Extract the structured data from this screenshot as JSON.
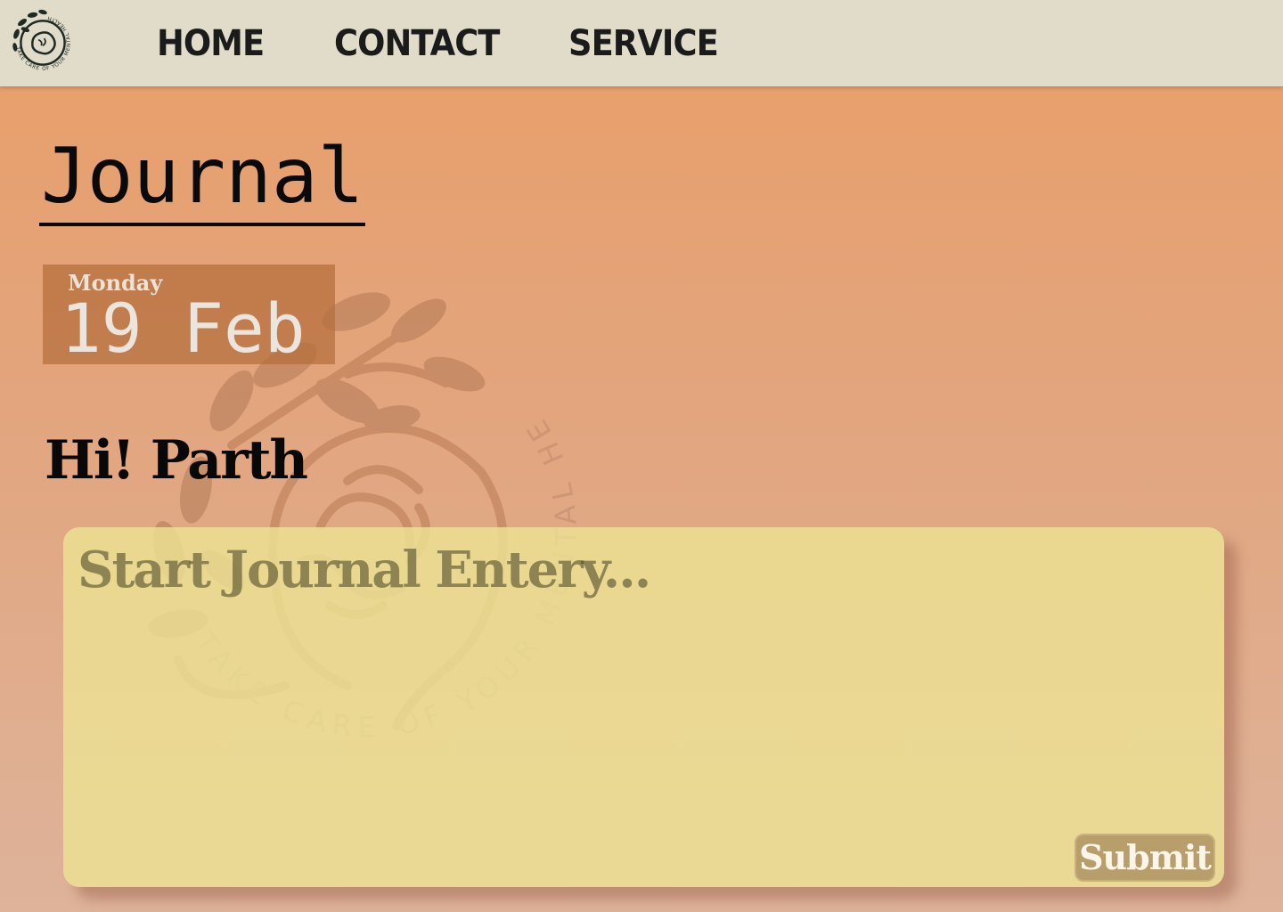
{
  "logo": {
    "icon": "mental-health-brain-logo-icon",
    "text": "TAKE CARE OF YOUR MENTAL HEALTH"
  },
  "nav": {
    "items": [
      {
        "label": "HOME"
      },
      {
        "label": "CONTACT"
      },
      {
        "label": "SERVICE"
      }
    ]
  },
  "page": {
    "title": "Journal",
    "date": {
      "weekday": "Monday",
      "day_month": "19 Feb"
    },
    "greeting": "Hi! Parth"
  },
  "entry": {
    "placeholder": "Start Journal Entery...",
    "value": "",
    "submit_label": "Submit"
  },
  "watermark": {
    "icon": "mental-health-brain-logo-icon",
    "text": "TAKE CARE OF YOUR MENTAL HEALTH"
  },
  "colors": {
    "navbar_bg": "#e1dcca",
    "page_gradient_top": "#ea9e68",
    "page_gradient_bottom": "#deb39a",
    "card_bg": "#e7e09a",
    "date_box_bg": "#b46e3c",
    "submit_bg": "#b89e6a"
  }
}
